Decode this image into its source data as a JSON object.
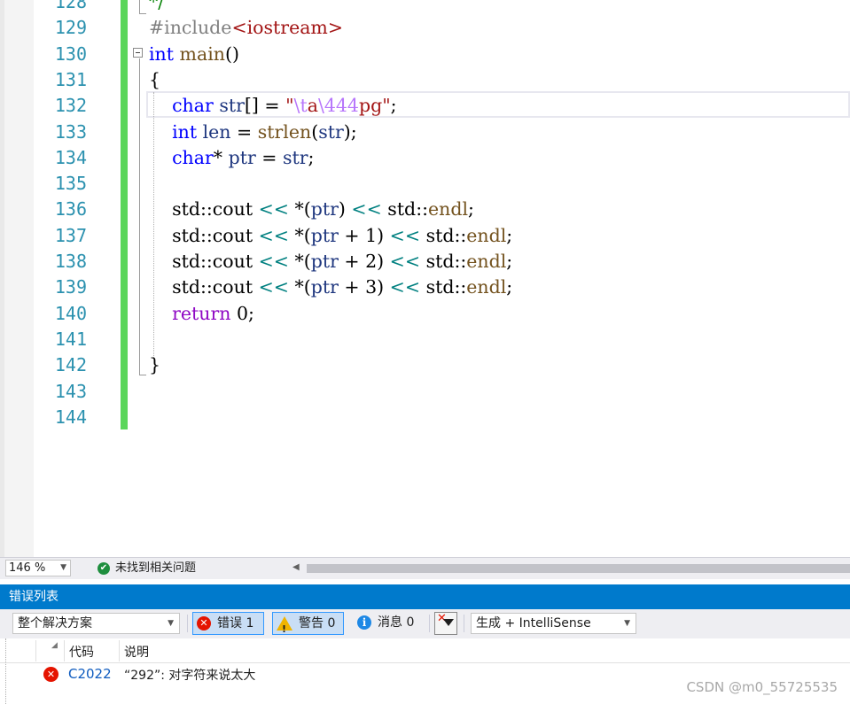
{
  "editor": {
    "lines": [
      {
        "num": "128",
        "tokens": [
          {
            "t": "*/",
            "c": "cmt"
          }
        ]
      },
      {
        "num": "129",
        "tokens": [
          {
            "t": "#include",
            "c": "pp"
          },
          {
            "t": "<iostream>",
            "c": "str"
          }
        ]
      },
      {
        "num": "130",
        "tokens": [
          {
            "t": "int",
            "c": "kw"
          },
          {
            "t": " ",
            "c": ""
          },
          {
            "t": "main",
            "c": "fn"
          },
          {
            "t": "()",
            "c": ""
          }
        ]
      },
      {
        "num": "131",
        "tokens": [
          {
            "t": "{",
            "c": ""
          }
        ]
      },
      {
        "num": "132",
        "tokens": [
          {
            "t": "    ",
            "c": ""
          },
          {
            "t": "char",
            "c": "kw"
          },
          {
            "t": " ",
            "c": ""
          },
          {
            "t": "str",
            "c": "var"
          },
          {
            "t": "[] = ",
            "c": ""
          },
          {
            "t": "\"",
            "c": "str"
          },
          {
            "t": "\\t",
            "c": "esc"
          },
          {
            "t": "a",
            "c": "str"
          },
          {
            "t": "\\444",
            "c": "esc"
          },
          {
            "t": "pg\"",
            "c": "str"
          },
          {
            "t": ";",
            "c": ""
          }
        ]
      },
      {
        "num": "133",
        "tokens": [
          {
            "t": "    ",
            "c": ""
          },
          {
            "t": "int",
            "c": "kw"
          },
          {
            "t": " ",
            "c": ""
          },
          {
            "t": "len",
            "c": "var"
          },
          {
            "t": " = ",
            "c": ""
          },
          {
            "t": "strlen",
            "c": "fn"
          },
          {
            "t": "(",
            "c": ""
          },
          {
            "t": "str",
            "c": "var"
          },
          {
            "t": ");",
            "c": ""
          }
        ]
      },
      {
        "num": "134",
        "tokens": [
          {
            "t": "    ",
            "c": ""
          },
          {
            "t": "char",
            "c": "kw"
          },
          {
            "t": "* ",
            "c": ""
          },
          {
            "t": "ptr",
            "c": "var"
          },
          {
            "t": " = ",
            "c": ""
          },
          {
            "t": "str",
            "c": "var"
          },
          {
            "t": ";",
            "c": ""
          }
        ]
      },
      {
        "num": "135",
        "tokens": []
      },
      {
        "num": "136",
        "tokens": [
          {
            "t": "    ",
            "c": ""
          },
          {
            "t": "std",
            "c": "ns"
          },
          {
            "t": "::",
            "c": ""
          },
          {
            "t": "cout",
            "c": "ns"
          },
          {
            "t": " ",
            "c": ""
          },
          {
            "t": "<<",
            "c": "op"
          },
          {
            "t": " *(",
            "c": ""
          },
          {
            "t": "ptr",
            "c": "var"
          },
          {
            "t": ") ",
            "c": ""
          },
          {
            "t": "<<",
            "c": "op"
          },
          {
            "t": " ",
            "c": ""
          },
          {
            "t": "std",
            "c": "ns"
          },
          {
            "t": "::",
            "c": ""
          },
          {
            "t": "endl",
            "c": "fn"
          },
          {
            "t": ";",
            "c": ""
          }
        ]
      },
      {
        "num": "137",
        "tokens": [
          {
            "t": "    ",
            "c": ""
          },
          {
            "t": "std",
            "c": "ns"
          },
          {
            "t": "::",
            "c": ""
          },
          {
            "t": "cout",
            "c": "ns"
          },
          {
            "t": " ",
            "c": ""
          },
          {
            "t": "<<",
            "c": "op"
          },
          {
            "t": " *(",
            "c": ""
          },
          {
            "t": "ptr",
            "c": "var"
          },
          {
            "t": " + ",
            "c": ""
          },
          {
            "t": "1",
            "c": "num"
          },
          {
            "t": ") ",
            "c": ""
          },
          {
            "t": "<<",
            "c": "op"
          },
          {
            "t": " ",
            "c": ""
          },
          {
            "t": "std",
            "c": "ns"
          },
          {
            "t": "::",
            "c": ""
          },
          {
            "t": "endl",
            "c": "fn"
          },
          {
            "t": ";",
            "c": ""
          }
        ]
      },
      {
        "num": "138",
        "tokens": [
          {
            "t": "    ",
            "c": ""
          },
          {
            "t": "std",
            "c": "ns"
          },
          {
            "t": "::",
            "c": ""
          },
          {
            "t": "cout",
            "c": "ns"
          },
          {
            "t": " ",
            "c": ""
          },
          {
            "t": "<<",
            "c": "op"
          },
          {
            "t": " *(",
            "c": ""
          },
          {
            "t": "ptr",
            "c": "var"
          },
          {
            "t": " + ",
            "c": ""
          },
          {
            "t": "2",
            "c": "num"
          },
          {
            "t": ") ",
            "c": ""
          },
          {
            "t": "<<",
            "c": "op"
          },
          {
            "t": " ",
            "c": ""
          },
          {
            "t": "std",
            "c": "ns"
          },
          {
            "t": "::",
            "c": ""
          },
          {
            "t": "endl",
            "c": "fn"
          },
          {
            "t": ";",
            "c": ""
          }
        ]
      },
      {
        "num": "139",
        "tokens": [
          {
            "t": "    ",
            "c": ""
          },
          {
            "t": "std",
            "c": "ns"
          },
          {
            "t": "::",
            "c": ""
          },
          {
            "t": "cout",
            "c": "ns"
          },
          {
            "t": " ",
            "c": ""
          },
          {
            "t": "<<",
            "c": "op"
          },
          {
            "t": " *(",
            "c": ""
          },
          {
            "t": "ptr",
            "c": "var"
          },
          {
            "t": " + ",
            "c": ""
          },
          {
            "t": "3",
            "c": "num"
          },
          {
            "t": ") ",
            "c": ""
          },
          {
            "t": "<<",
            "c": "op"
          },
          {
            "t": " ",
            "c": ""
          },
          {
            "t": "std",
            "c": "ns"
          },
          {
            "t": "::",
            "c": ""
          },
          {
            "t": "endl",
            "c": "fn"
          },
          {
            "t": ";",
            "c": ""
          }
        ]
      },
      {
        "num": "140",
        "tokens": [
          {
            "t": "    ",
            "c": ""
          },
          {
            "t": "return",
            "c": "kwp"
          },
          {
            "t": " ",
            "c": ""
          },
          {
            "t": "0",
            "c": "num"
          },
          {
            "t": ";",
            "c": ""
          }
        ]
      },
      {
        "num": "141",
        "tokens": []
      },
      {
        "num": "142",
        "tokens": [
          {
            "t": "}",
            "c": ""
          }
        ]
      },
      {
        "num": "143",
        "tokens": []
      },
      {
        "num": "144",
        "tokens": []
      }
    ]
  },
  "status_bar": {
    "zoom": "146 %",
    "issues_text": "未找到相关问题"
  },
  "error_list": {
    "title": "错误列表",
    "scope": "整个解决方案",
    "errors_label": "错误 1",
    "warnings_label": "警告 0",
    "messages_label": "消息 0",
    "source": "生成 + IntelliSense",
    "columns": {
      "code": "代码",
      "description": "说明"
    },
    "rows": [
      {
        "code": "C2022",
        "description": "“292”: 对字符来说太大"
      }
    ]
  },
  "watermark": "CSDN @m0_55725535"
}
